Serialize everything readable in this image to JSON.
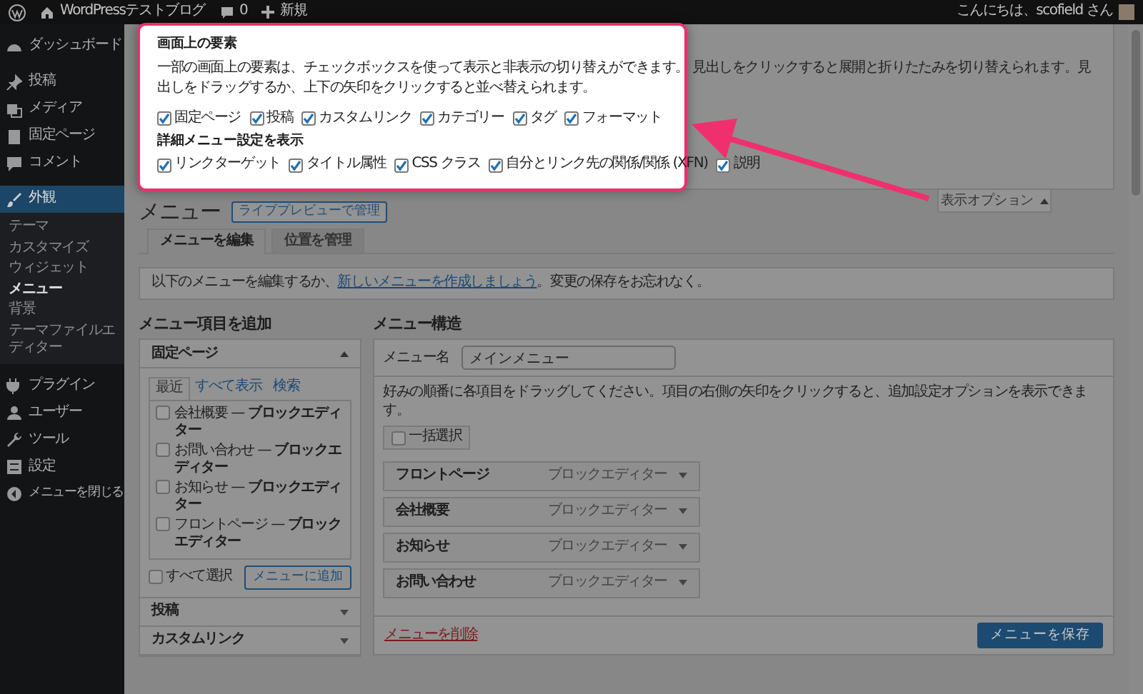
{
  "admin_bar": {
    "site_title": "WordPressテストブログ",
    "comments_count": "0",
    "new_label": "新規",
    "greeting": "こんにちは、scofield さん"
  },
  "sidebar": {
    "items": [
      {
        "label": "ダッシュボード",
        "selected": false
      },
      {
        "label": "投稿",
        "selected": false
      },
      {
        "label": "メディア",
        "selected": false
      },
      {
        "label": "固定ページ",
        "selected": false
      },
      {
        "label": "コメント",
        "selected": false
      },
      {
        "label": "外観",
        "selected": true,
        "children": [
          {
            "label": "テーマ",
            "selected": false
          },
          {
            "label": "カスタマイズ",
            "selected": false
          },
          {
            "label": "ウィジェット",
            "selected": false
          },
          {
            "label": "メニュー",
            "selected": true
          },
          {
            "label": "背景",
            "selected": false
          },
          {
            "label": "テーマファイルエディター",
            "selected": false
          }
        ]
      },
      {
        "label": "プラグイン",
        "selected": false
      },
      {
        "label": "ユーザー",
        "selected": false
      },
      {
        "label": "ツール",
        "selected": false
      },
      {
        "label": "設定",
        "selected": false
      },
      {
        "label": "メニューを閉じる",
        "selected": false
      }
    ]
  },
  "screen_options": {
    "title": "画面上の要素",
    "description": "一部の画面上の要素は、チェックボックスを使って表示と非表示の切り替えができます。 見出しをクリックすると展開と折りたたみを切り替えられます。見出しをドラッグするか、上下の矢印をクリックすると並べ替えられます。",
    "boxes": [
      {
        "label": "固定ページ",
        "checked": true
      },
      {
        "label": "投稿",
        "checked": true
      },
      {
        "label": "カスタムリンク",
        "checked": true
      },
      {
        "label": "カテゴリー",
        "checked": true
      },
      {
        "label": "タグ",
        "checked": true
      },
      {
        "label": "フォーマット",
        "checked": true
      }
    ],
    "advanced_title": "詳細メニュー設定を表示",
    "advanced": [
      {
        "label": "リンクターゲット",
        "checked": true
      },
      {
        "label": "タイトル属性",
        "checked": true
      },
      {
        "label": "CSS クラス",
        "checked": true
      },
      {
        "label": "自分とリンク先の関係/関係 (XFN)",
        "checked": true
      },
      {
        "label": "説明",
        "checked": true
      }
    ],
    "toggle_label": "表示オプション",
    "expanded": true
  },
  "page": {
    "title": "メニュー",
    "live_preview_button": "ライブプレビューで管理",
    "tabs": [
      {
        "label": "メニューを編集",
        "selected": true
      },
      {
        "label": "位置を管理",
        "selected": false
      }
    ],
    "notice": {
      "before": "以下のメニューを編集するか、",
      "link": "新しいメニューを作成しましょう",
      "after": "。変更の保存をお忘れなく。"
    }
  },
  "add_items": {
    "title": "メニュー項目を追加",
    "sections": [
      {
        "title": "固定ページ",
        "expanded": true,
        "tabs": [
          {
            "label": "最近",
            "selected": true
          },
          {
            "label": "すべて表示",
            "selected": false
          },
          {
            "label": "検索",
            "selected": false
          }
        ],
        "items": [
          {
            "label": "会社概要 — **ブロックエディター**",
            "checked": false
          },
          {
            "label": "お問い合わせ — **ブロックエディター**",
            "checked": false
          },
          {
            "label": "お知らせ — **ブロックエディター**",
            "checked": false
          },
          {
            "label": "フロントページ — **ブロックエディター**",
            "checked": false
          }
        ],
        "select_all": {
          "label": "すべて選択",
          "checked": false
        },
        "add_button": "メニューに追加"
      },
      {
        "title": "投稿",
        "expanded": false
      },
      {
        "title": "カスタムリンク",
        "expanded": false
      }
    ]
  },
  "structure": {
    "title": "メニュー構造",
    "name_label": "メニュー名",
    "name_value": "メインメニュー",
    "instructions": "好みの順番に各項目をドラッグしてください。項目の右側の矢印をクリックすると、追加設定オプションを表示できます。",
    "bulk_select": {
      "label": "一括選択",
      "checked": false
    },
    "items": [
      {
        "title": "フロントページ",
        "type": "ブロックエディター"
      },
      {
        "title": "会社概要",
        "type": "ブロックエディター"
      },
      {
        "title": "お知らせ",
        "type": "ブロックエディター"
      },
      {
        "title": "お問い合わせ",
        "type": "ブロックエディター"
      }
    ],
    "delete_link": "メニューを削除",
    "save_button": "メニューを保存"
  }
}
